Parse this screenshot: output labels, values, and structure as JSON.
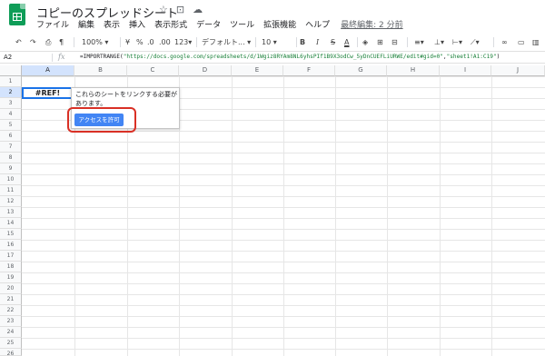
{
  "header": {
    "title": "コピーのスプレッドシート",
    "menu": [
      "ファイル",
      "編集",
      "表示",
      "挿入",
      "表示形式",
      "データ",
      "ツール",
      "拡張機能",
      "ヘルプ"
    ],
    "last_edit": "最終編集: 2 分前"
  },
  "toolbar": {
    "zoom": "100%",
    "currency": "¥",
    "percent": "%",
    "dec_decrease": ".0",
    "dec_increase": ".00",
    "number_format": "123",
    "font": "デフォルト...",
    "font_size": "10",
    "bold": "B",
    "italic": "I",
    "strikethrough": "S",
    "text_color": "A"
  },
  "formula_bar": {
    "name_box": "A2",
    "fx": "fx",
    "formula_prefix": "=IMPORTRANGE(",
    "formula_url": "\"https://docs.google.com/spreadsheets/d/1Wgiz8RYAm8NL6yhsPIf1B9X3odCw_5yDnCUEFLiURWE/edit#gid=0\"",
    "formula_sep": ",",
    "formula_range": "\"sheet1!A1:C19\"",
    "formula_suffix": ")"
  },
  "grid": {
    "columns": [
      "A",
      "B",
      "C",
      "D",
      "E",
      "F",
      "G",
      "H",
      "I",
      "J"
    ],
    "rows": [
      "1",
      "2",
      "3",
      "4",
      "5",
      "6",
      "7",
      "8",
      "9",
      "10",
      "11",
      "12",
      "13",
      "14",
      "15",
      "16",
      "17",
      "18",
      "19",
      "20",
      "21",
      "22",
      "23",
      "24",
      "25",
      "26"
    ],
    "selected_column": "A",
    "selected_row": "2",
    "active_cell_value": "#REF!"
  },
  "popup": {
    "message": "これらのシートをリンクする必要があります。",
    "button_label": "アクセスを許可"
  },
  "colors": {
    "accent": "#1a73e8",
    "button": "#4285f4",
    "highlight_ring": "#d93025",
    "logo": "#0f9d58"
  }
}
